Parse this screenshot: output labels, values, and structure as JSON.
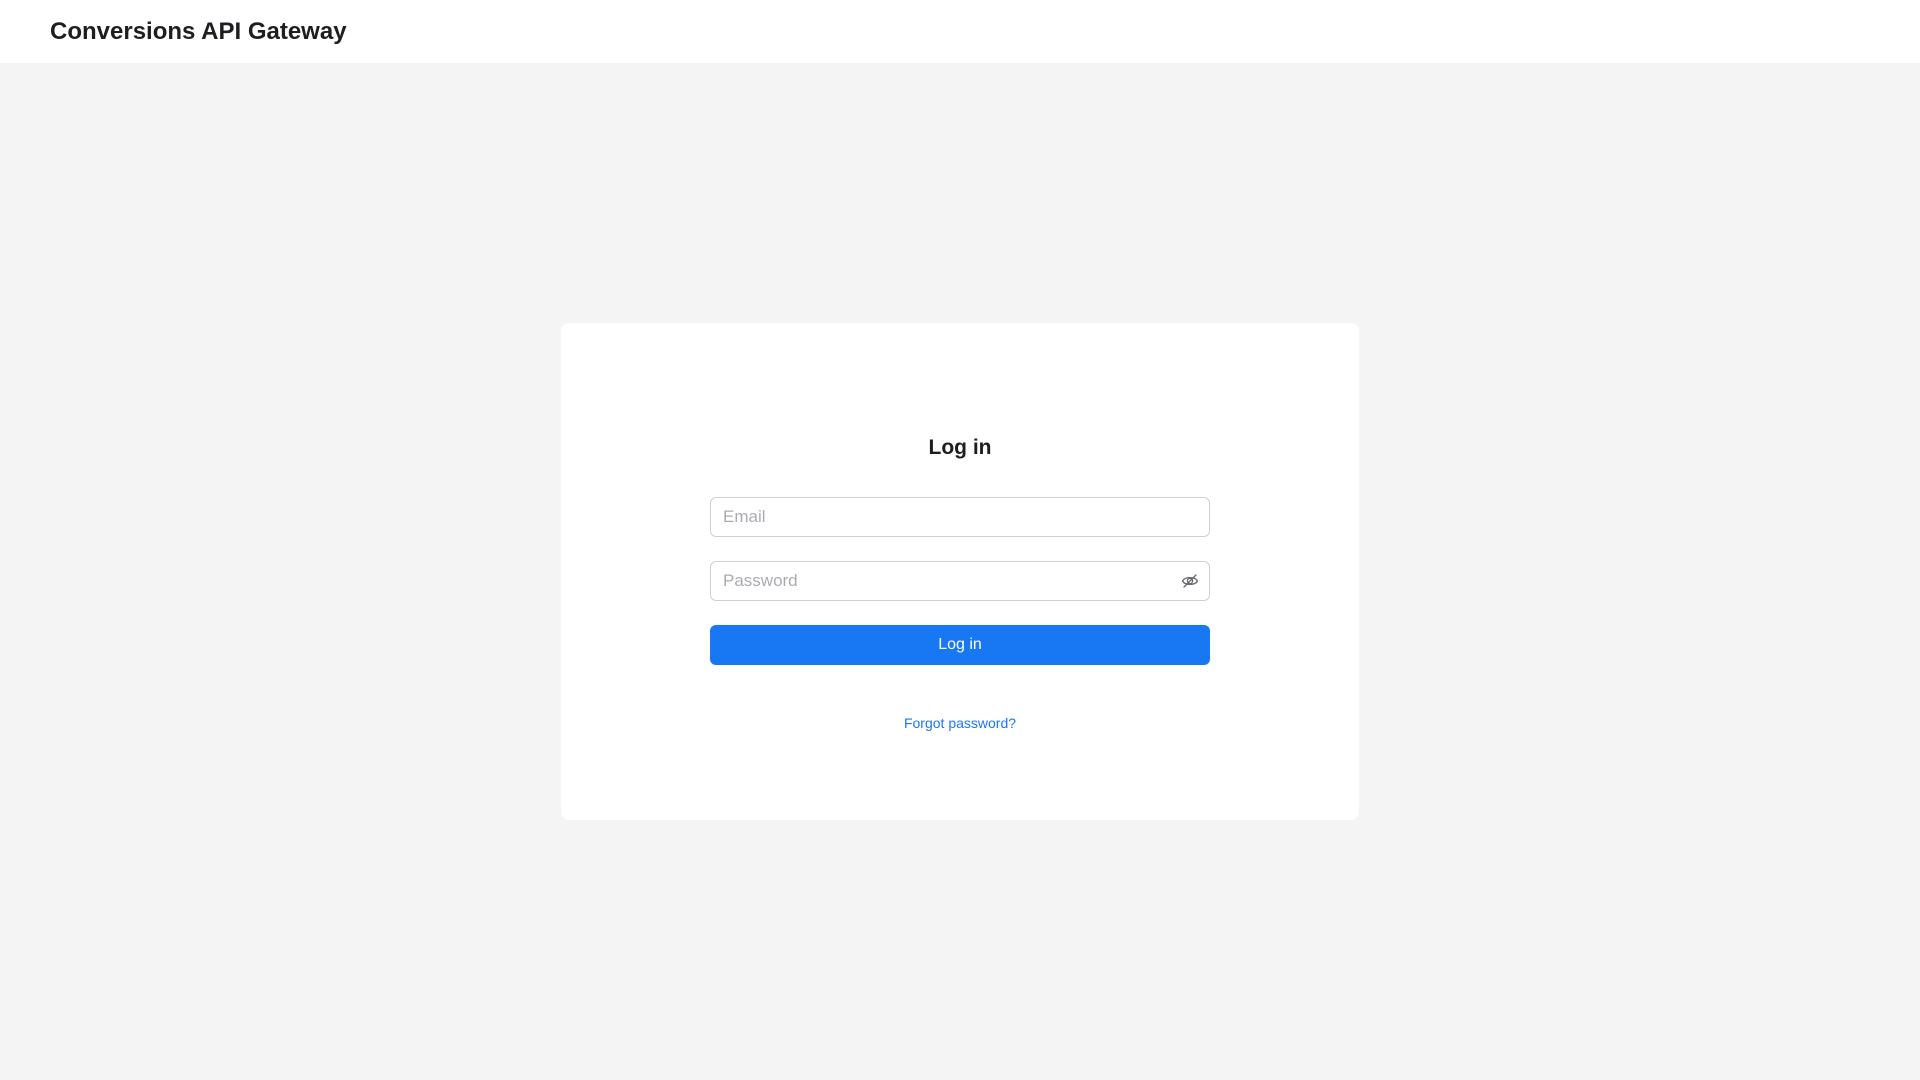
{
  "header": {
    "title": "Conversions API Gateway"
  },
  "login": {
    "title": "Log in",
    "email_placeholder": "Email",
    "password_placeholder": "Password",
    "password_toggle_icon": "eye-slash-icon",
    "submit_label": "Log in",
    "forgot_password_label": "Forgot password?"
  },
  "colors": {
    "accent": "#1877f2",
    "page_background": "#f4f4f4",
    "card_background": "#ffffff",
    "input_border": "#cdd0d4",
    "text_primary": "#1c1e21"
  }
}
